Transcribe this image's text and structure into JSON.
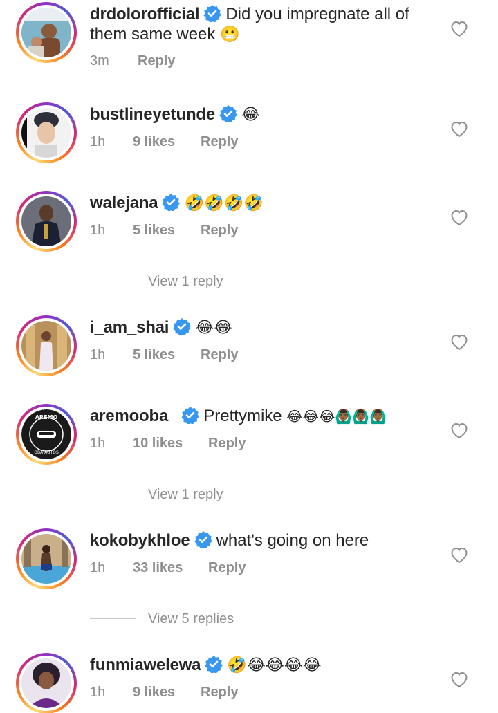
{
  "comments": [
    {
      "username": "drdolorofficial",
      "text": "Did you impregnate all of",
      "text_line2": "them same week",
      "emoji": "😬",
      "time": "3m",
      "likes": "",
      "reply": "Reply",
      "verified": true
    },
    {
      "username": "bustlineyetunde",
      "text": "",
      "emoji": "😂",
      "time": "1h",
      "likes": "9 likes",
      "reply": "Reply",
      "verified": true
    },
    {
      "username": "walejana",
      "text": "",
      "emoji": "🤣🤣🤣🤣",
      "time": "1h",
      "likes": "5 likes",
      "reply": "Reply",
      "verified": true,
      "view_replies": "View 1 reply"
    },
    {
      "username": "i_am_shai",
      "text": "",
      "emoji": "😂😂",
      "time": "1h",
      "likes": "5 likes",
      "reply": "Reply",
      "verified": true
    },
    {
      "username": "aremooba_",
      "text": "Prettymike",
      "emoji": "😂😂😂🙆🏾‍♂️🙆🏾‍♂️🙆🏾‍♂️",
      "time": "1h",
      "likes": "10 likes",
      "reply": "Reply",
      "verified": true,
      "view_replies": "View 1 reply",
      "avatar_text": "AREMO OBA AUTOS"
    },
    {
      "username": "kokobykhloe",
      "text": "what's going on here",
      "emoji": "",
      "time": "1h",
      "likes": "33 likes",
      "reply": "Reply",
      "verified": true,
      "view_replies": "View 5 replies"
    },
    {
      "username": "funmiawelewa",
      "text": "",
      "emoji": "🤣😂😂😂😂",
      "time": "1h",
      "likes": "9 likes",
      "reply": "Reply",
      "verified": true
    }
  ],
  "icons": {
    "verified": "verified-badge-icon",
    "like": "heart-outline-icon"
  },
  "colors": {
    "verified_blue": "#3897f0",
    "meta_gray": "#8e8e8e",
    "text": "#262626"
  }
}
